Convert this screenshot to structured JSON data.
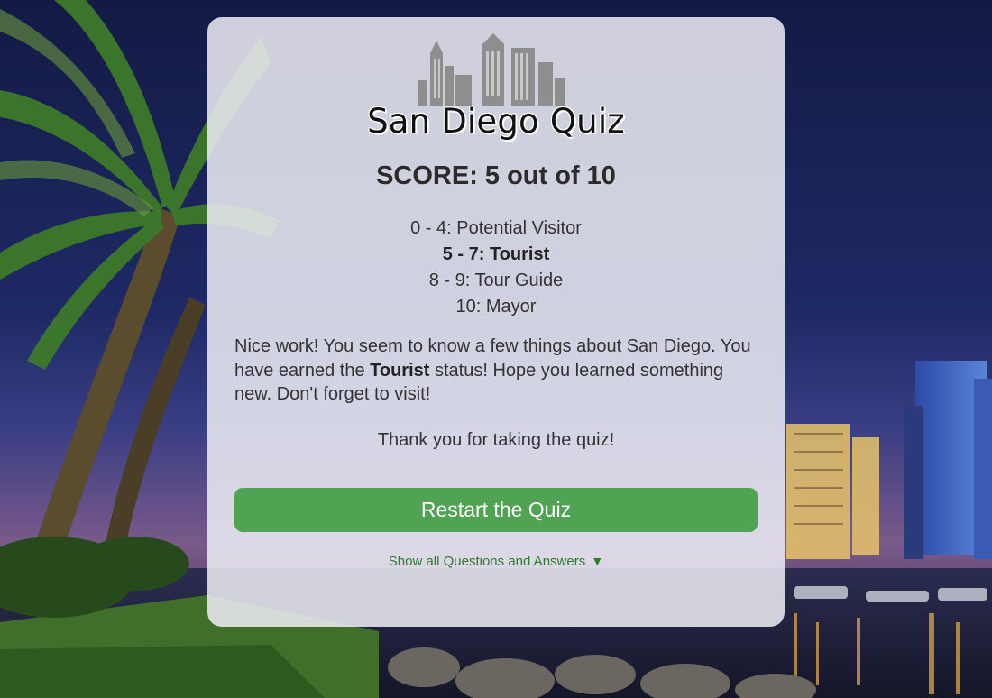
{
  "app": {
    "title": "San Diego Quiz"
  },
  "result": {
    "score_text": "SCORE: 5 out of 10",
    "score": 5,
    "total": 10
  },
  "ranks": [
    {
      "label": "0 - 4: Potential Visitor",
      "active": false
    },
    {
      "label": "5 - 7: Tourist",
      "active": true
    },
    {
      "label": "8 - 9: Tour Guide",
      "active": false
    },
    {
      "label": "10: Mayor",
      "active": false
    }
  ],
  "message": {
    "part1": "Nice work! You seem to know a few things about San Diego. You have earned the ",
    "status": "Tourist",
    "part2": " status! Hope you learned something new. Don't forget to visit!"
  },
  "thanks": "Thank you for taking the quiz!",
  "actions": {
    "restart_label": "Restart the Quiz",
    "show_all_label": "Show all Questions and Answers",
    "show_all_icon": "triangle-down-icon",
    "show_all_glyph": "▼"
  },
  "colors": {
    "button": "#4fa352",
    "link": "#2f7a36",
    "card": "#eeeef4"
  },
  "icons": {
    "logo": "skyline-icon"
  }
}
